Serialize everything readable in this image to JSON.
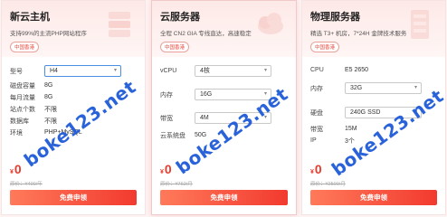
{
  "watermark": "boke123.net",
  "cards": [
    {
      "title": "新云主机",
      "subtitle": "支持99%的主流PHP网站程序",
      "badge": "中国香港",
      "specs": [
        {
          "label": "型号",
          "value": "H4",
          "select": true
        },
        {
          "label": "磁盘容量",
          "value": "8G"
        },
        {
          "label": "每月流量",
          "value": "8G"
        },
        {
          "label": "站点个数",
          "value": "不限"
        },
        {
          "label": "数据库",
          "value": "不限"
        },
        {
          "label": "环境",
          "value": "PHP+MySQL"
        }
      ],
      "price_symbol": "¥",
      "price": "0",
      "orig_price": "原价：¥400/年",
      "button": "免费申领"
    },
    {
      "title": "云服务器",
      "subtitle": "全程 CN2 GIA 专线直达，高速稳定",
      "badge": "中国香港",
      "specs": [
        {
          "label": "vCPU",
          "value": "4核",
          "select": true
        },
        {
          "label": "内存",
          "value": "16G",
          "select": true
        },
        {
          "label": "带宽",
          "value": "4M",
          "select": true
        },
        {
          "label": "云系统盘",
          "value": "50G"
        }
      ],
      "price_symbol": "¥",
      "price": "0",
      "orig_price": "原价：¥762/月",
      "button": "免费申领"
    },
    {
      "title": "物理服务器",
      "subtitle": "精选 T3+ 机房，7*24H 金牌技术服务",
      "badge": "中国香港",
      "specs": [
        {
          "label": "CPU",
          "value": "E5 2650"
        },
        {
          "label": "内存",
          "value": "32G",
          "select": true
        },
        {
          "label": "硬盘",
          "value": "240G SSD",
          "select": true
        },
        {
          "label": "带宽",
          "value": "15M"
        },
        {
          "label": "IP",
          "value": "3个"
        }
      ],
      "price_symbol": "¥",
      "price": "0",
      "orig_price": "原价：¥2500/月",
      "button": "免费申领"
    }
  ]
}
